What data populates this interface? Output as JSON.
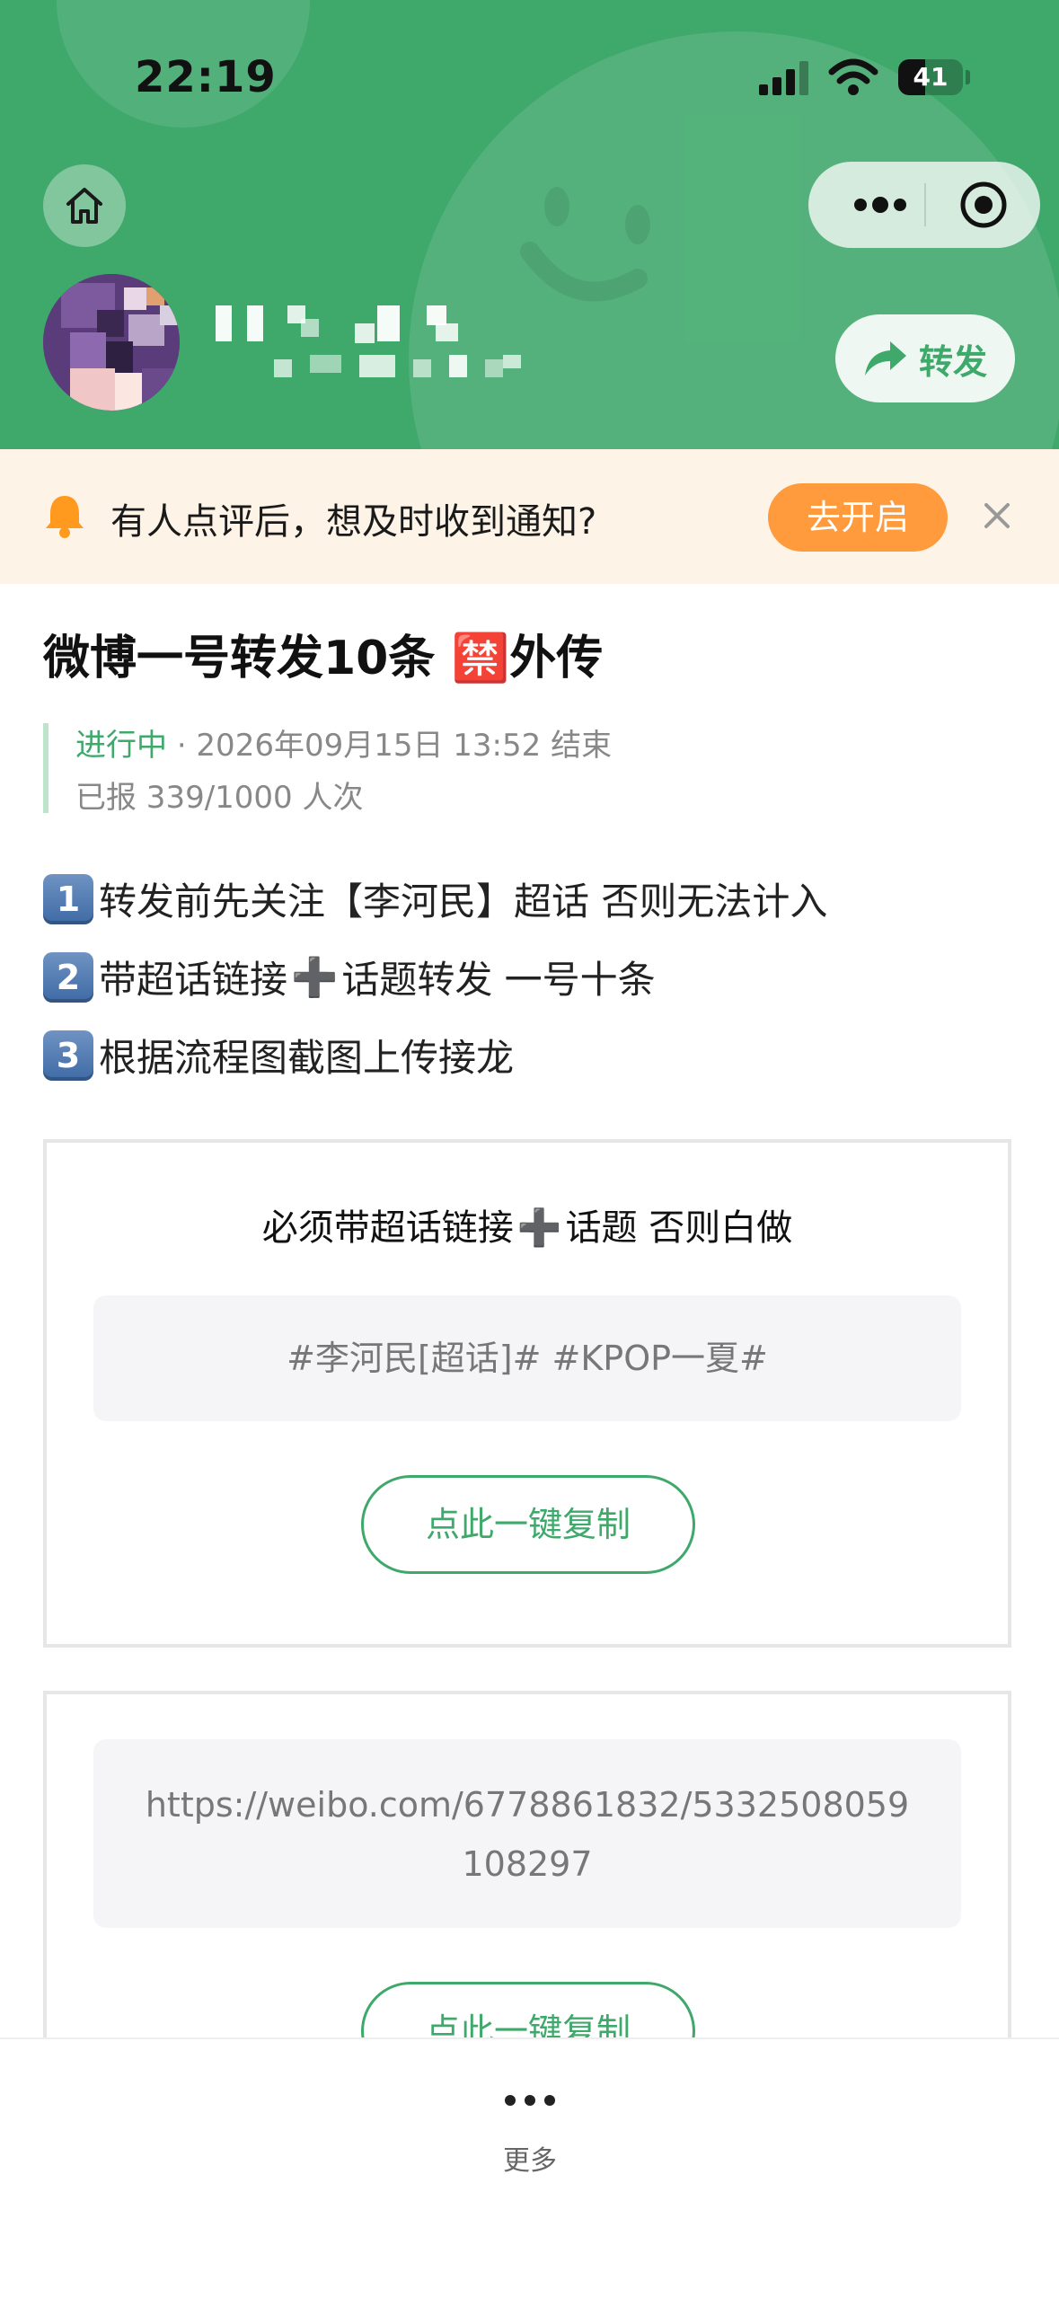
{
  "status_bar": {
    "time": "22:19",
    "battery": "41",
    "battery_level": 0.41
  },
  "header": {
    "share_label": "转发",
    "icons": {
      "home": "home-icon",
      "more": "more-dots-icon",
      "close": "target-close-icon",
      "share": "share-arrow-icon"
    },
    "brand_color": "#3fa86b"
  },
  "notice": {
    "text": "有人点评后，想及时收到通知?",
    "button_label": "去开启",
    "accent": "#ff9a3d"
  },
  "post": {
    "title": "微博一号转发10条 🈲外传",
    "status": "进行中",
    "end_info": "· 2026年09月15日 13:52 结束",
    "reported": "已报 339/1000 人次",
    "steps": [
      {
        "num": "1",
        "text": "转发前先关注【李河民】超话 否则无法计入"
      },
      {
        "num": "2",
        "text_before": "带超话链接",
        "plus": "➕",
        "text_after": "话题转发 一号十条"
      },
      {
        "num": "3",
        "text": "根据流程图截图上传接龙"
      }
    ]
  },
  "card1": {
    "title_before": "必须带超话链接",
    "title_plus": "➕",
    "title_after": "话题 否则白做",
    "code": "#李河民[超话]# #KPOP一夏#",
    "copy_label": "点此一键复制"
  },
  "card2": {
    "url_line1": "https://weibo.com/6778861832/5332508059",
    "url_line2": "108297",
    "copy_label": "点此一键复制"
  },
  "bottom": {
    "more_label": "更多"
  }
}
